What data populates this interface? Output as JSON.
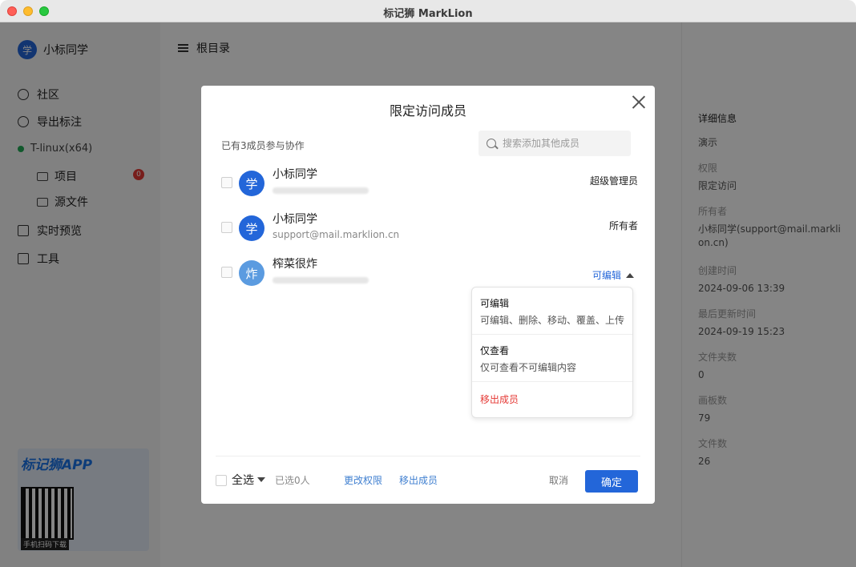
{
  "window": {
    "title": "标记狮 MarkLion"
  },
  "sidebar": {
    "user": {
      "avatar": "学",
      "name": "小标同学"
    },
    "items": [
      {
        "label": "社区",
        "icon": "community-icon"
      },
      {
        "label": "导出标注",
        "icon": "export-icon"
      }
    ],
    "workspace": {
      "label": "T-linux(x64)"
    },
    "sub_items": [
      {
        "label": "项目",
        "icon": "folder-icon",
        "badge": "0"
      },
      {
        "label": "源文件",
        "icon": "tag-icon"
      }
    ],
    "items2": [
      {
        "label": "实时预览",
        "icon": "phone-icon"
      },
      {
        "label": "工具",
        "icon": "cube-icon"
      }
    ],
    "promo": {
      "title": "标记狮APP",
      "qr_caption": "手机扫码下载"
    }
  },
  "main": {
    "header_title": "根目录"
  },
  "right_panel": {
    "header": "详细信息",
    "name": "演示",
    "permission_label": "权限",
    "permission": "限定访问",
    "owner_label": "所有者",
    "owner": "小标同学(support@mail.marklion.cn)",
    "created_label": "创建时间",
    "created": "2024-09-06 13:39",
    "updated_label": "最后更新时间",
    "updated": "2024-09-19 15:23",
    "folders_label": "文件夹数",
    "folders": "0",
    "boards_label": "画板数",
    "boards": "79",
    "files_label": "文件数",
    "files": "26"
  },
  "modal": {
    "title": "限定访问成员",
    "count_text": "已有3成员参与协作",
    "search_placeholder": "搜索添加其他成员",
    "members": [
      {
        "avatar": "学",
        "name": "小标同学",
        "email": "",
        "role": "超级管理员"
      },
      {
        "avatar": "学",
        "name": "小标同学",
        "email": "support@mail.marklion.cn",
        "role": "所有者"
      },
      {
        "avatar": "炸",
        "name": "榨菜很炸",
        "email": "",
        "role": "可编辑"
      }
    ],
    "footer": {
      "select_all": "全选",
      "selected_count": "已选0人",
      "change_permission": "更改权限",
      "remove_members": "移出成员",
      "cancel": "取消",
      "confirm": "确定"
    }
  },
  "permission_dropdown": {
    "current": "可编辑",
    "options": [
      {
        "title": "可编辑",
        "desc": "可编辑、删除、移动、覆盖、上传"
      },
      {
        "title": "仅查看",
        "desc": "仅可查看不可编辑内容"
      }
    ],
    "remove": "移出成员"
  }
}
